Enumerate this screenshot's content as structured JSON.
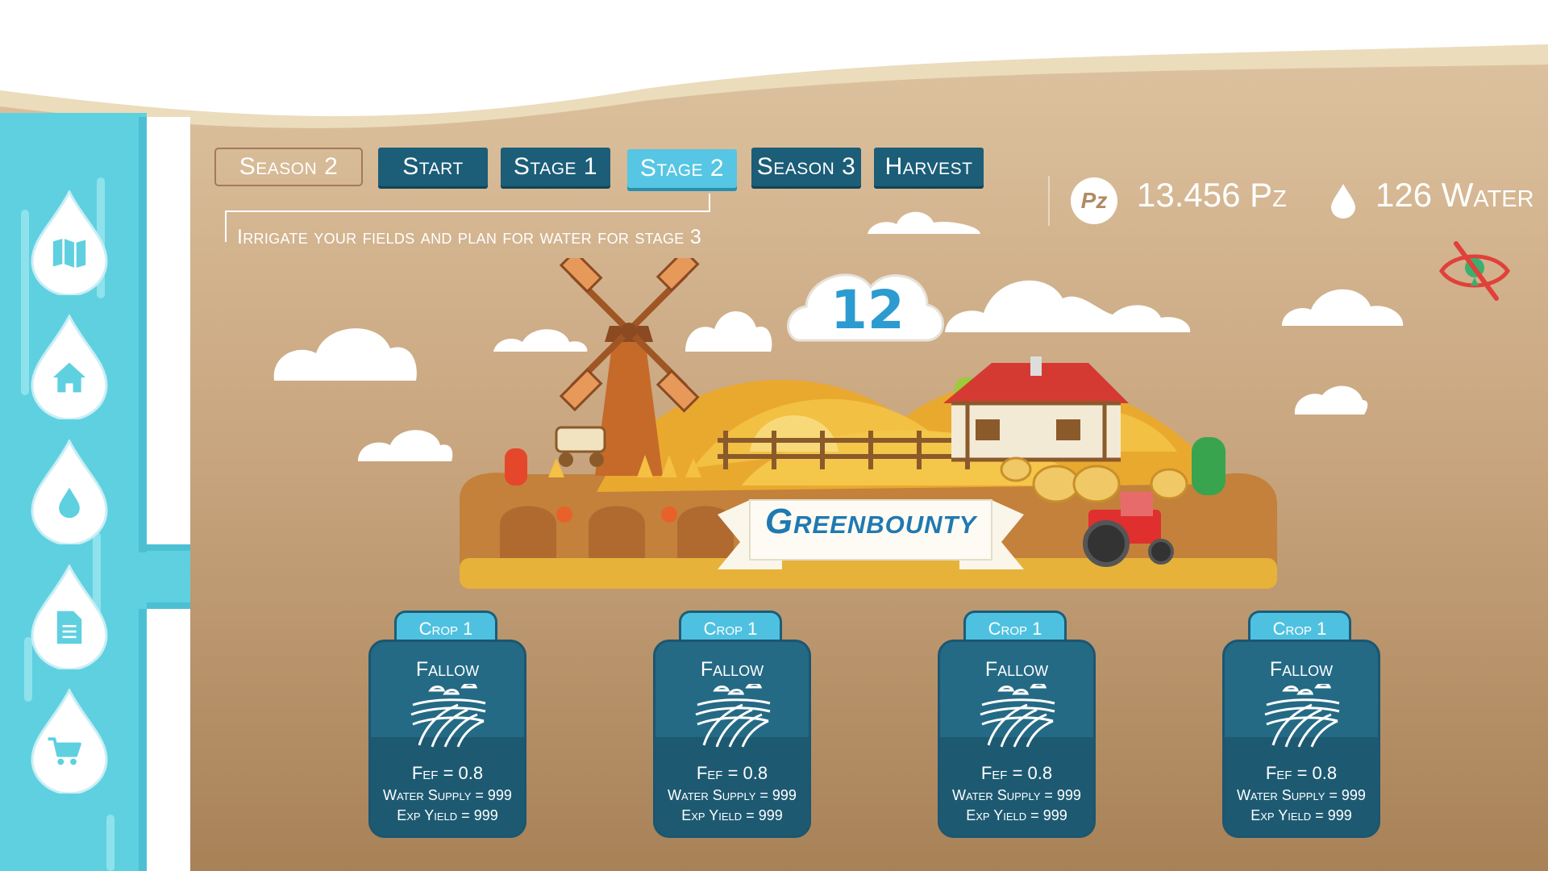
{
  "game": {
    "title": "Greenbounty",
    "turn_number": "12"
  },
  "sidebar": {
    "items": [
      {
        "icon": "map-icon"
      },
      {
        "icon": "home-icon"
      },
      {
        "icon": "water-drop-icon"
      },
      {
        "icon": "document-icon"
      },
      {
        "icon": "shopping-cart-icon"
      }
    ]
  },
  "nav": {
    "current_label": "Season 2",
    "tabs": [
      "Start",
      "Stage 1",
      "Stage 2",
      "Season 3",
      "Harvest"
    ],
    "active_tab": "Stage 2"
  },
  "instruction": "Irrigate your fields and plan for water for stage 3",
  "resources": {
    "currency_symbol": "Pz",
    "currency": "13.456 Pz",
    "water": "126 Water"
  },
  "visibility_toggle": {
    "icon": "eye-hidden-icon"
  },
  "crops": [
    {
      "tab": "Crop 1",
      "state": "Fallow",
      "fef": "Fef = 0.8",
      "water_supply": "Water Supply = 999",
      "exp_yield": "Exp Yield = 999"
    },
    {
      "tab": "Crop 1",
      "state": "Fallow",
      "fef": "Fef = 0.8",
      "water_supply": "Water Supply = 999",
      "exp_yield": "Exp Yield = 999"
    },
    {
      "tab": "Crop 1",
      "state": "Fallow",
      "fef": "Fef = 0.8",
      "water_supply": "Water Supply = 999",
      "exp_yield": "Exp Yield = 999"
    },
    {
      "tab": "Crop 1",
      "state": "Fallow",
      "fef": "Fef = 0.8",
      "water_supply": "Water Supply = 999",
      "exp_yield": "Exp Yield = 999"
    }
  ],
  "colors": {
    "sidebar": "#5fd0e0",
    "nav_dark": "#1c5d78",
    "nav_active": "#56c6e4",
    "card": "#246a85",
    "ground_top": "#d8b890",
    "ground_bottom": "#a88258"
  }
}
